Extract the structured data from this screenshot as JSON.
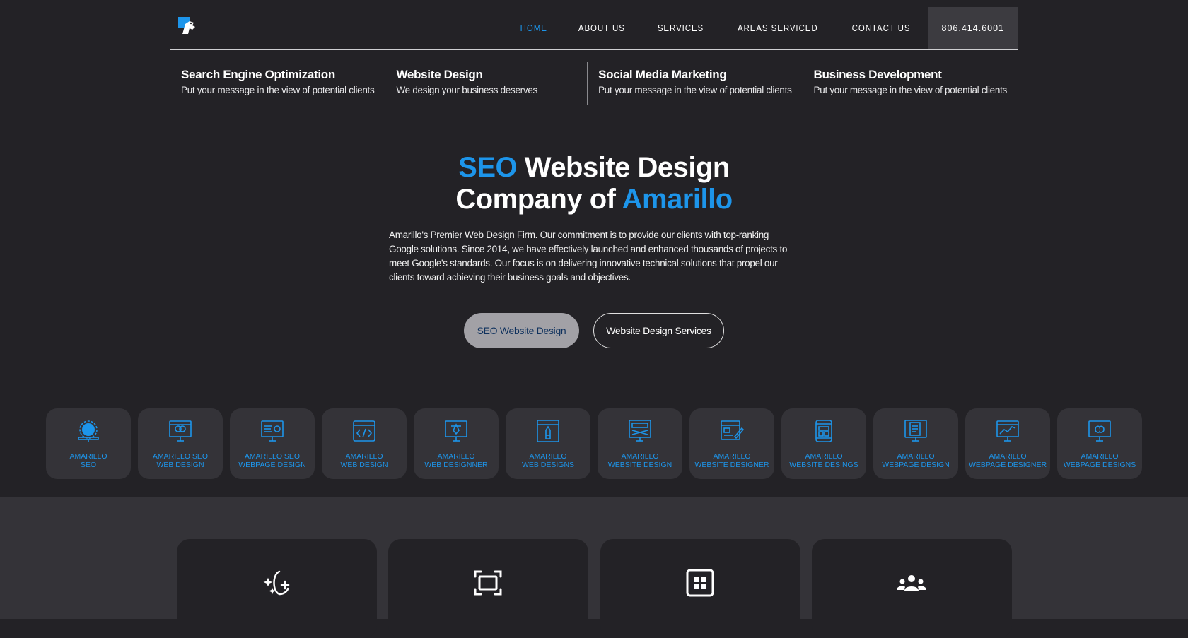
{
  "nav": {
    "items": [
      {
        "label": "HOME",
        "active": true
      },
      {
        "label": "ABOUT US",
        "active": false
      },
      {
        "label": "SERVICES",
        "active": false
      },
      {
        "label": "AREAS SERVICED",
        "active": false
      },
      {
        "label": "CONTACT US",
        "active": false
      }
    ],
    "phone": "806.414.6001"
  },
  "services": [
    {
      "title": "Search Engine Optimization",
      "desc": "Put your message in the view of potential clients"
    },
    {
      "title": "Website Design",
      "desc": "We design your business deserves"
    },
    {
      "title": "Social Media Marketing",
      "desc": "Put your message in the view of potential clients"
    },
    {
      "title": "Business Development",
      "desc": "Put your message in the view of potential clients"
    }
  ],
  "hero": {
    "title_part1": "SEO",
    "title_part2": "Website Design",
    "title_part3": "Company of",
    "title_part4": "Amarillo",
    "body": "Amarillo's Premier Web Design Firm. Our commitment is to provide our clients with top-ranking Google solutions. Since 2014, we have effectively launched and enhanced thousands of projects to meet Google's standards. Our focus is on delivering innovative technical solutions that propel our clients toward achieving their business goals and objectives.",
    "primary_button": "SEO Website Design",
    "secondary_button": "Website Design Services"
  },
  "tiles": [
    {
      "line1": "AMARILLO",
      "line2": "SEO",
      "icon": "seo-gear-monitor-icon"
    },
    {
      "line1": "AMARILLO SEO",
      "line2": "WEB DESIGN",
      "icon": "monitor-design-icon"
    },
    {
      "line1": "AMARILLO SEO",
      "line2": "WEBPAGE DESIGN",
      "icon": "monitor-settings-icon"
    },
    {
      "line1": "AMARILLO",
      "line2": "WEB DESIGN",
      "icon": "browser-code-icon"
    },
    {
      "line1": "AMARILLO",
      "line2": "WEB DESIGNNER",
      "icon": "monitor-pen-icon"
    },
    {
      "line1": "AMARILLO",
      "line2": "WEB DESIGNS",
      "icon": "browser-pencil-icon"
    },
    {
      "line1": "AMARILLO",
      "line2": "WEBSITE DESIGN",
      "icon": "monitor-layout-icon"
    },
    {
      "line1": "AMARILLO",
      "line2": "WEBSITE DESIGNER",
      "icon": "browser-edit-icon"
    },
    {
      "line1": "AMARILLO",
      "line2": "WEBSITE DESINGS",
      "icon": "tablet-layout-icon"
    },
    {
      "line1": "AMARILLO",
      "line2": "WEBPAGE DESIGN",
      "icon": "monitor-document-icon"
    },
    {
      "line1": "AMARILLO",
      "line2": "WEBPAGE DESIGNER",
      "icon": "monitor-chart-icon"
    },
    {
      "line1": "AMARILLO",
      "line2": "WEBPAGE DESIGNS",
      "icon": "monitor-brain-icon"
    }
  ],
  "feature_cards": [
    {
      "icon": "sparkle-moon-plus-icon"
    },
    {
      "icon": "screen-frame-icon"
    },
    {
      "icon": "grid-box-icon"
    },
    {
      "icon": "group-people-icon"
    }
  ],
  "colors": {
    "accent": "#1d95ea",
    "background": "#232226",
    "panel": "#343338"
  }
}
